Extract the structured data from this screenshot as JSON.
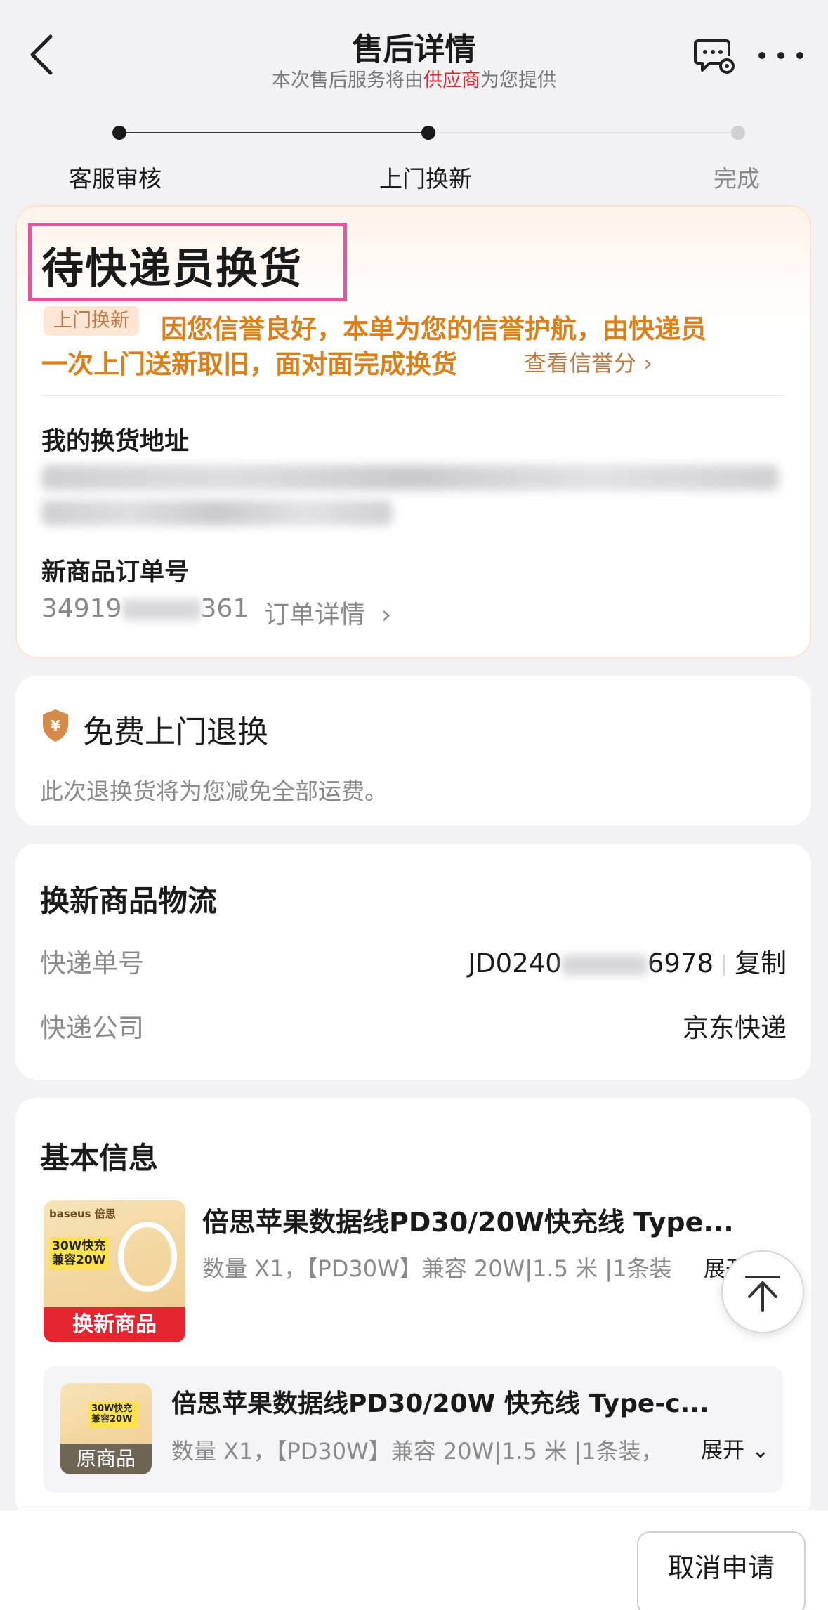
{
  "header": {
    "title": "售后详情",
    "subtitle_prefix": "本次售后服务将由",
    "subtitle_highlight": "供应商",
    "subtitle_suffix": "为您提供",
    "highlight_color": "#e4252f"
  },
  "progress": {
    "steps": [
      {
        "label": "客服审核",
        "state": "done"
      },
      {
        "label": "上门换新",
        "state": "current"
      },
      {
        "label": "完成",
        "state": "pending"
      }
    ]
  },
  "status": {
    "title": "待快递员换货",
    "tag": "上门换新",
    "message_line1": "因您信誉良好，本单为您的信誉护航，由快递员",
    "message_line2": "一次上门送新取旧，面对面完成换货",
    "link": "查看信誉分",
    "accent_color": "#d9801b"
  },
  "address": {
    "label": "我的换货地址"
  },
  "new_order": {
    "label": "新商品订单号",
    "number_start": "34919",
    "number_end": "361",
    "detail_link": "订单详情"
  },
  "free_service": {
    "title": "免费上门退换",
    "description": "此次退换货将为您减免全部运费。"
  },
  "logistics": {
    "title": "换新商品物流",
    "tracking_label": "快递单号",
    "tracking_start": "JD0240",
    "tracking_end": "6978",
    "copy_label": "复制",
    "company_label": "快递公司",
    "company_value": "京东快递"
  },
  "basic_info": {
    "title": "基本信息",
    "products": [
      {
        "badge": "换新商品",
        "name": "倍思苹果数据线PD30/20W快充线 Type...",
        "spec": "数量 X1，【PD30W】兼容 20W|1.5 米 |1条装",
        "expand": "展开",
        "thumb_brand": "baseus 倍思",
        "thumb_promo": "30W快充 兼容20W"
      },
      {
        "badge": "原商品",
        "name": "倍思苹果数据线PD30/20W 快充线 Type-c...",
        "spec": "数量 X1，【PD30W】兼容 20W|1.5 米 |1条装，",
        "expand": "展开",
        "thumb_promo": "30W快充 兼容20W"
      }
    ]
  },
  "footer": {
    "cancel_label": "取消申请"
  }
}
